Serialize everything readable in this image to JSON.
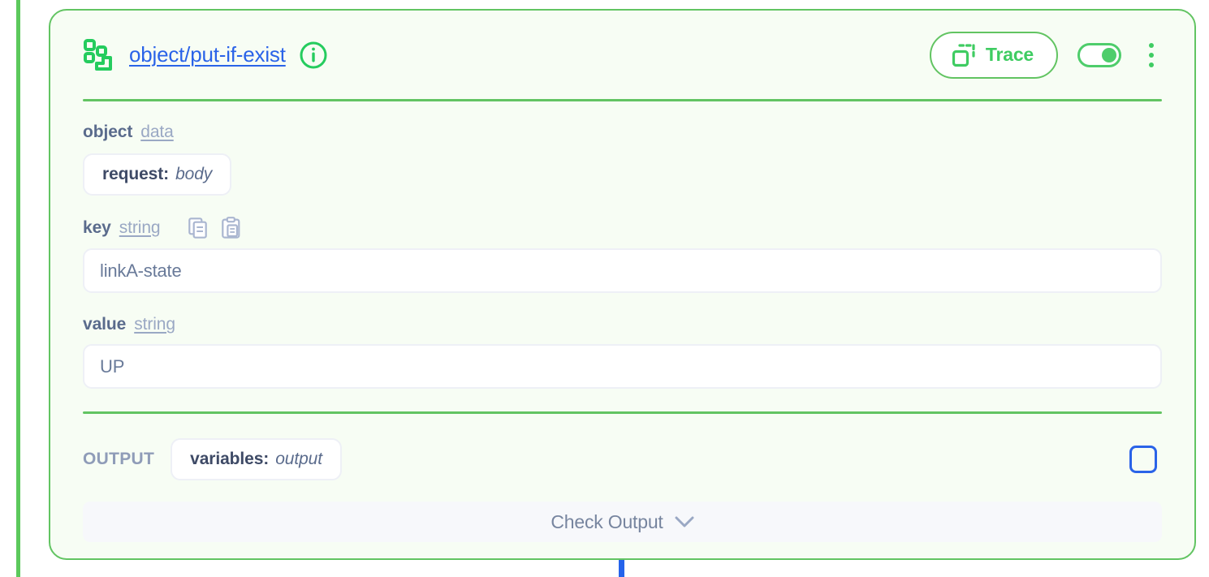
{
  "node": {
    "icon": "schema-object-icon",
    "title": "object/put-if-exist",
    "info_icon": "info-icon",
    "trace_button_label": "Trace",
    "trace_icon": "duplicate-icon",
    "toggle_state": "on",
    "kebab_icon": "kebab-menu-icon",
    "accent_color": "#62c462",
    "link_color": "#2a63e8",
    "card_background": "#f7fdf4"
  },
  "fields": {
    "object": {
      "name": "object",
      "type": "data",
      "chip_key": "request:",
      "chip_value": "body"
    },
    "key": {
      "name": "key",
      "type": "string",
      "copy_icon": "copy-icon",
      "paste_icon": "paste-icon",
      "value": "linkA-state",
      "placeholder": "key"
    },
    "value": {
      "name": "value",
      "type": "string",
      "value": "UP",
      "placeholder": "value"
    }
  },
  "output": {
    "label": "OUTPUT",
    "chip_key": "variables:",
    "chip_value": "output",
    "checkbox_checked": false,
    "checkbox_color": "#2a63e8",
    "check_output_label": "Check Output",
    "chevron_icon": "chevron-down-icon"
  },
  "canvas": {
    "flow_rail_color": "#5cc95c",
    "connector_color": "#2563eb"
  }
}
